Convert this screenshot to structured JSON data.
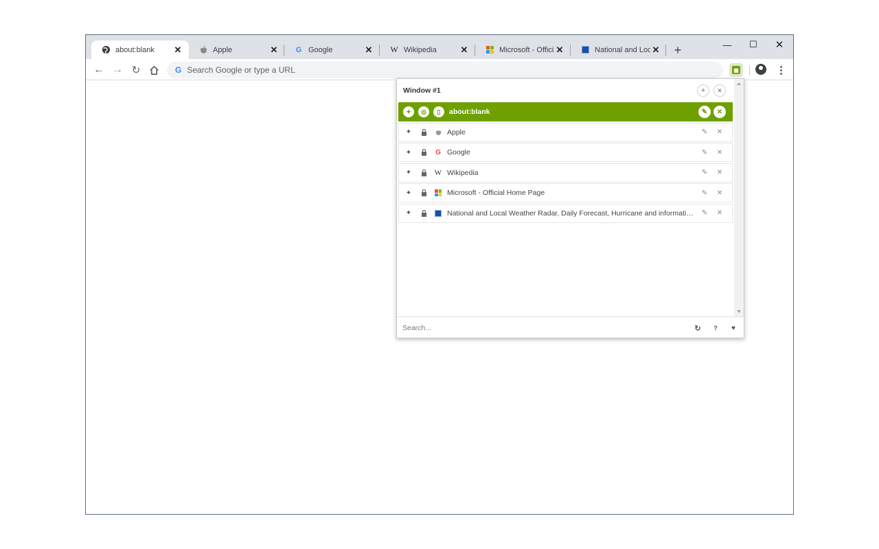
{
  "browser": {
    "tabs": [
      {
        "title": "about:blank",
        "icon": "globe-icon"
      },
      {
        "title": "Apple",
        "icon": "apple-icon"
      },
      {
        "title": "Google",
        "icon": "google-icon"
      },
      {
        "title": "Wikipedia",
        "icon": "wikipedia-icon"
      },
      {
        "title": "Microsoft - Official Home Page",
        "icon": "microsoft-icon"
      },
      {
        "title": "National and Local Weather Radar",
        "icon": "weather-channel-icon"
      }
    ],
    "omnibox_placeholder": "Search Google or type a URL",
    "google_glyph": "G"
  },
  "popup": {
    "window_title": "Window #1",
    "tabs": [
      {
        "title": "about:blank",
        "favicon": "page-icon"
      },
      {
        "title": "Apple",
        "favicon": "apple-icon"
      },
      {
        "title": "Google",
        "favicon": "google-icon"
      },
      {
        "title": "Wikipedia",
        "favicon": "wikipedia-icon"
      },
      {
        "title": "Microsoft - Official Home Page",
        "favicon": "microsoft-icon"
      },
      {
        "title": "National and Local Weather Radar, Daily Forecast, Hurricane and information from The Weather Channel and weather.com",
        "favicon": "weather-channel-icon"
      }
    ],
    "search_placeholder": "Search..."
  },
  "colors": {
    "accent": "#6ea100",
    "tabstrip": "#dee1e6"
  }
}
